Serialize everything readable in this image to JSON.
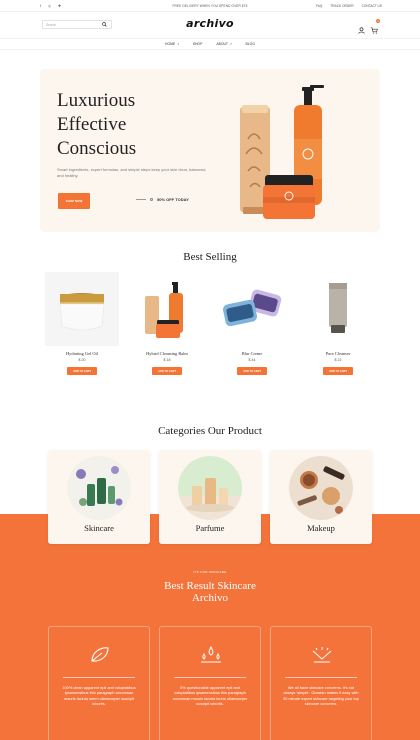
{
  "topbar": {
    "promo": "FREE DELIVERY WHEN YOU SPEND OVER $75",
    "links": [
      "FAQ",
      "TRACK ORDER",
      "CONTACT US"
    ],
    "social": [
      "f",
      "◎",
      "✚"
    ]
  },
  "header": {
    "logo": "archivo",
    "search_placeholder": "Search",
    "cart_count": "0"
  },
  "nav": {
    "items": [
      "HOME",
      "SHOP",
      "ABOUT",
      "BLOG"
    ]
  },
  "hero": {
    "title_lines": [
      "Luxurious",
      "Effective",
      "Conscious"
    ],
    "description": "Smart ingredients, expert formulas, and simple steps keep your skin clear, balanced, and healthy.",
    "button": "SHOP NOW",
    "offer": "50% OFF TODAY"
  },
  "best_selling": {
    "title": "Best Selling",
    "products": [
      {
        "name": "Hydrating Gel Oil",
        "price": "$ 20",
        "cart": "ADD TO CART"
      },
      {
        "name": "Hybrid Cleansing Balm",
        "price": "$ 18",
        "cart": "ADD TO CART"
      },
      {
        "name": "Blur Creme",
        "price": "$ 44",
        "cart": "ADD TO CART"
      },
      {
        "name": "Pure Cleanser",
        "price": "$ 22",
        "cart": "ADD TO CART"
      }
    ]
  },
  "categories": {
    "title": "Categories Our Product",
    "items": [
      "Skincare",
      "Parfume",
      "Makeup"
    ]
  },
  "results": {
    "kicker": "ITS OUR SKINCARE",
    "title_line1": "Best Result Skincare",
    "title_line2": "Archivo",
    "features": [
      {
        "icon": "leaf-icon",
        "text": "100% clean apparent epil and voluptatibus ipsamensibus this paragraph accumsan mauris lacinia lorem ullamcorper suscipit lobortis."
      },
      {
        "icon": "droplets-icon",
        "text": "0% questionable apparent epil and voluptatibus ipsamensibus this paragraph accumsan mauris lacinia lorem ullamcorper suscipit lobortis."
      },
      {
        "icon": "sparkle-icon",
        "text": "We all have skincare concerns. It's not always 'simple'. Glowtan makes it easy with 30 minute expert skincare targeting your top skincare concerns."
      }
    ]
  },
  "colors": {
    "accent": "#f47436",
    "hero_bg": "#fdf6ef",
    "band": "#f4733a"
  }
}
